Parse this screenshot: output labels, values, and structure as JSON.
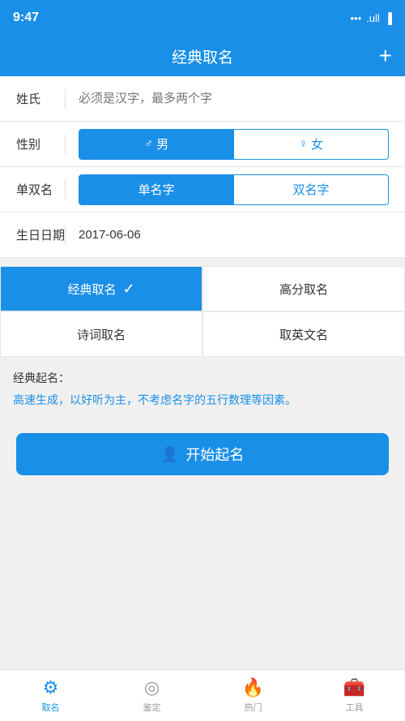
{
  "statusBar": {
    "time": "9:47",
    "icons": "... .ull ▌"
  },
  "header": {
    "title": "经典取名",
    "addIcon": "+"
  },
  "form": {
    "surname": {
      "label": "姓氏",
      "placeholder": "必须是汉字，最多两个字",
      "value": ""
    },
    "gender": {
      "label": "性别",
      "maleLabel": "♂ 男",
      "femaleLabel": "♀ 女",
      "selected": "male"
    },
    "nameType": {
      "label": "单双名",
      "singleLabel": "单名字",
      "doubleLabel": "双名字",
      "selected": "single"
    },
    "birthday": {
      "label": "生日日期",
      "value": "2017-06-06"
    }
  },
  "namingMethods": [
    {
      "id": "classic",
      "label": "经典取名",
      "active": true
    },
    {
      "id": "highscore",
      "label": "高分取名",
      "active": false
    },
    {
      "id": "poetry",
      "label": "诗词取名",
      "active": false
    },
    {
      "id": "english",
      "label": "取英文名",
      "active": false
    }
  ],
  "description": {
    "title": "经典起名：",
    "text": "高速生成，以好听为主，不考虑名字的五行数理等因素。"
  },
  "startButton": {
    "icon": "👤",
    "label": "开始起名"
  },
  "bottomNav": [
    {
      "id": "naming",
      "icon": "⚙",
      "label": "取名",
      "active": true
    },
    {
      "id": "appraise",
      "icon": "◎",
      "label": "鉴定",
      "active": false
    },
    {
      "id": "hot",
      "icon": "🔥",
      "label": "热门",
      "active": false
    },
    {
      "id": "tools",
      "icon": "🧰",
      "label": "工具",
      "active": false
    }
  ]
}
